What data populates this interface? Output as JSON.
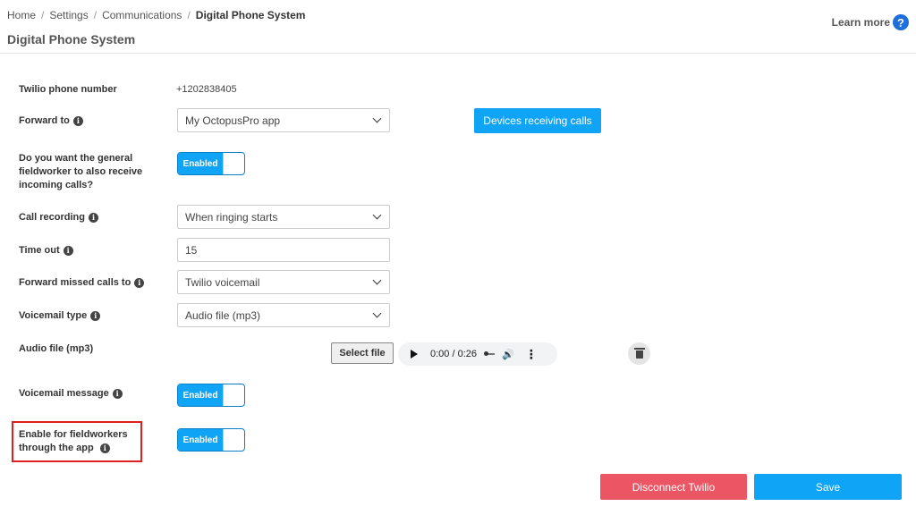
{
  "breadcrumb": {
    "items": [
      "Home",
      "Settings",
      "Communications"
    ],
    "current": "Digital Phone System",
    "separator": "/"
  },
  "page": {
    "title": "Digital Phone System"
  },
  "learn_more": {
    "label": "Learn more",
    "icon": "question-circle-icon",
    "icon_glyph": "?"
  },
  "info_glyph": "i",
  "form": {
    "twilio_number": {
      "label": "Twilio phone number",
      "value": "+1202838405"
    },
    "forward_to": {
      "label": "Forward to",
      "selected": "My OctopusPro app"
    },
    "devices_button": "Devices receiving calls",
    "general_fieldworker": {
      "label": "Do you want the general fieldworker to also receive incoming calls?",
      "toggle": "Enabled"
    },
    "call_recording": {
      "label": "Call recording",
      "selected": "When ringing starts"
    },
    "time_out": {
      "label": "Time out",
      "value": "15"
    },
    "forward_missed": {
      "label": "Forward missed calls to",
      "selected": "Twilio voicemail"
    },
    "voicemail_type": {
      "label": "Voicemail type",
      "selected": "Audio file (mp3)"
    },
    "audio_file": {
      "label": "Audio file (mp3)",
      "select_button": "Select file",
      "player_time": "0:00 / 0:26"
    },
    "voicemail_message": {
      "label": "Voicemail message",
      "toggle": "Enabled"
    },
    "enable_fieldworkers": {
      "label": "Enable for fieldworkers through the app",
      "toggle": "Enabled"
    }
  },
  "actions": {
    "disconnect": "Disconnect Twilio",
    "save": "Save"
  },
  "colors": {
    "primary": "#0fa4f5",
    "danger": "#eb5564",
    "highlight": "#e02020",
    "help_icon": "#1e6fd9"
  }
}
